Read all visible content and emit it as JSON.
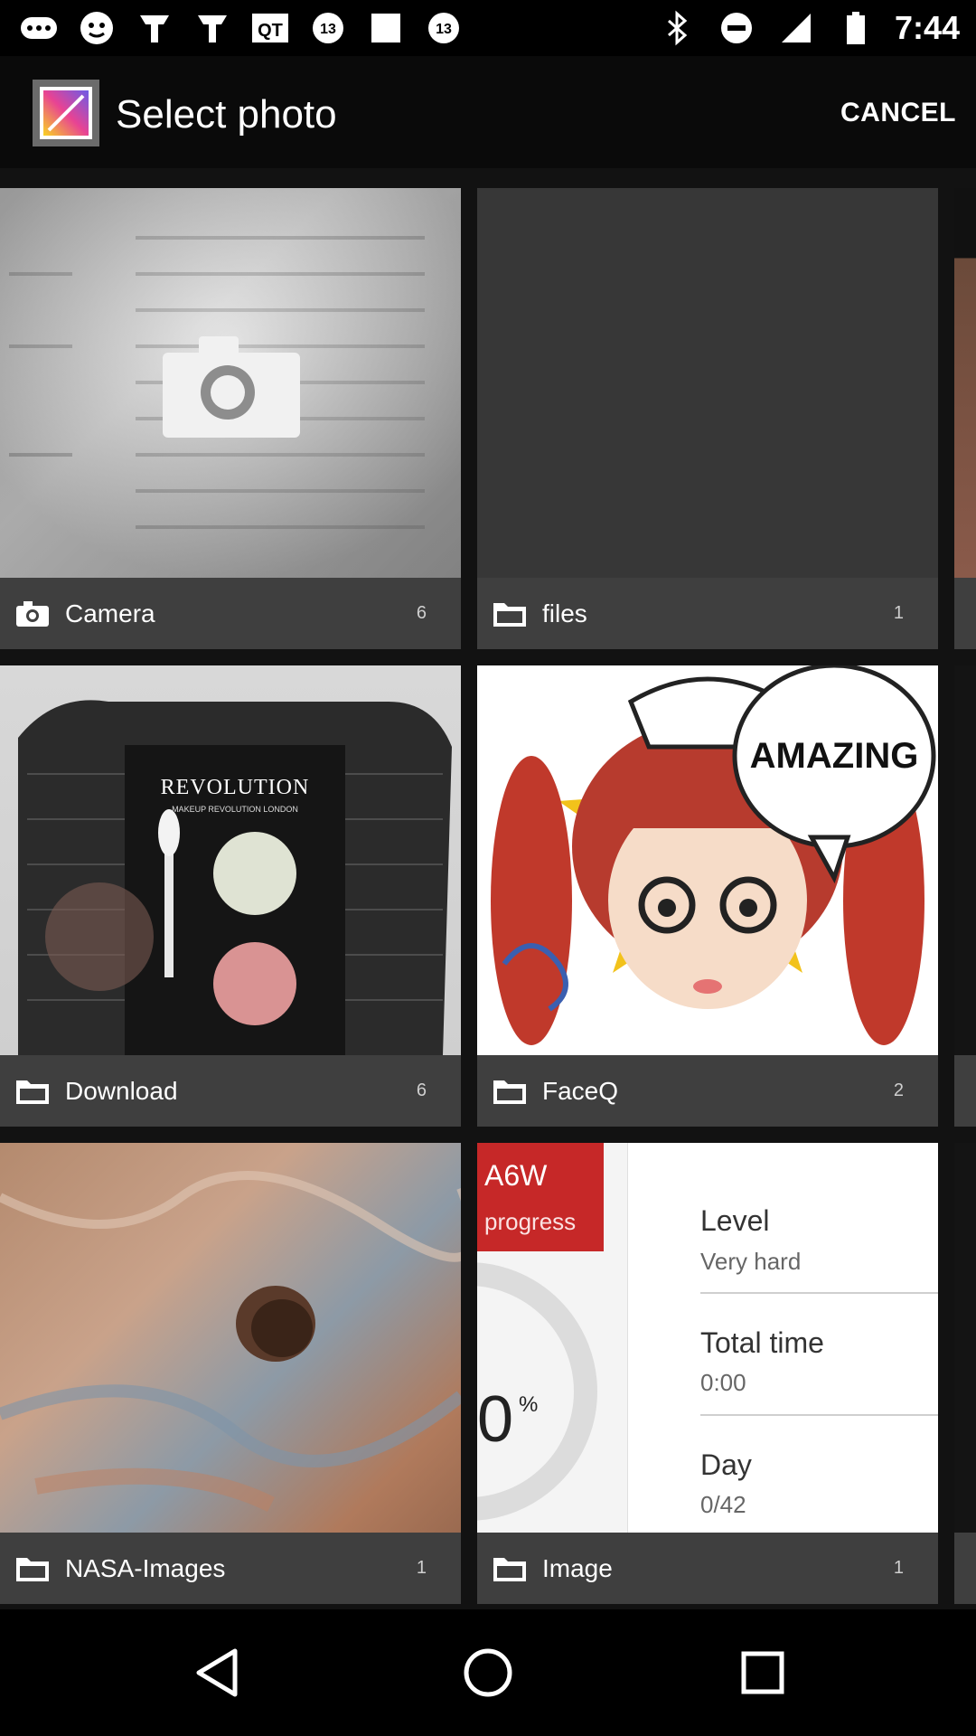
{
  "status_bar": {
    "time": "7:44",
    "left_icons": [
      "more-dots-icon",
      "gamepad-icon",
      "bird-icon",
      "bird-icon",
      "qt-icon",
      "abc13-icon",
      "image-icon",
      "abc13-icon"
    ],
    "right_icons": [
      "bluetooth-icon",
      "do-not-disturb-icon",
      "signal-icon",
      "battery-icon"
    ]
  },
  "action_bar": {
    "title": "Select photo",
    "cancel_label": "CANCEL"
  },
  "albums": [
    {
      "name": "Camera",
      "count": "6",
      "icon": "camera-icon"
    },
    {
      "name": "files",
      "count": "1",
      "icon": "folder-icon"
    },
    {
      "name": "Download",
      "count": "6",
      "icon": "folder-icon"
    },
    {
      "name": "FaceQ",
      "count": "2",
      "icon": "folder-icon"
    },
    {
      "name": "NASA-Images",
      "count": "1",
      "icon": "folder-icon"
    },
    {
      "name": "Image",
      "count": "1",
      "icon": "folder-icon"
    }
  ],
  "thumbnail_text": {
    "revolution_brand": "REVOLUTION",
    "revolution_sub": "MAKEUP REVOLUTION LONDON",
    "faceq_bubble": "AMAZING",
    "image_app_title": "A6W",
    "image_app_sub": "progress",
    "image_percent": "0",
    "image_percent_sign": "%",
    "image_stats": [
      {
        "label": "Level",
        "value": "Very hard"
      },
      {
        "label": "Total time",
        "value": "0:00"
      },
      {
        "label": "Day",
        "value": "0/42"
      }
    ]
  },
  "nav_bar": {
    "buttons": [
      "back-icon",
      "home-icon",
      "recents-icon"
    ]
  },
  "colors": {
    "actionbar": "#0a0a0a",
    "grid_bg": "#121212",
    "label_bg": "#404040",
    "accent_red": "#c62828"
  }
}
